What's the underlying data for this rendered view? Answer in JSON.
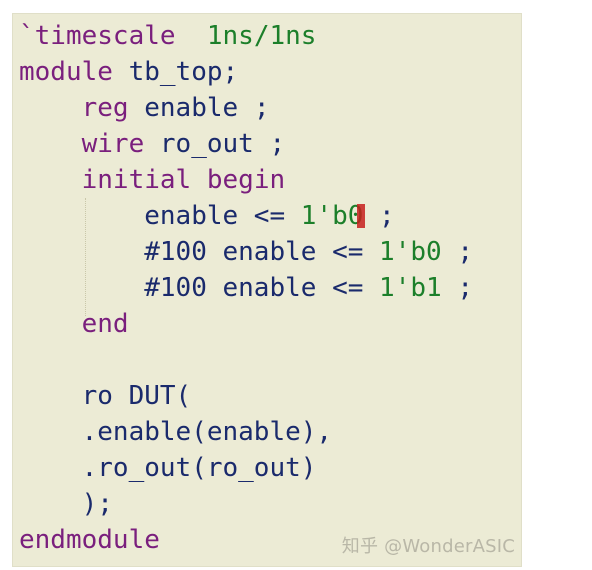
{
  "code": {
    "lines": [
      {
        "indent": "",
        "parts": [
          {
            "t": "kw",
            "v": "`timescale"
          },
          {
            "t": "sp",
            "v": "  "
          },
          {
            "t": "str",
            "v": "1ns/1ns"
          }
        ]
      },
      {
        "indent": "",
        "parts": [
          {
            "t": "kw",
            "v": "module"
          },
          {
            "t": "sp",
            "v": " "
          },
          {
            "t": "id",
            "v": "tb_top;"
          }
        ]
      },
      {
        "indent": "    ",
        "parts": [
          {
            "t": "kw",
            "v": "reg"
          },
          {
            "t": "sp",
            "v": " "
          },
          {
            "t": "id",
            "v": "enable ;"
          }
        ]
      },
      {
        "indent": "    ",
        "parts": [
          {
            "t": "kw",
            "v": "wire"
          },
          {
            "t": "sp",
            "v": " "
          },
          {
            "t": "id",
            "v": "ro_out ;"
          }
        ]
      },
      {
        "indent": "    ",
        "parts": [
          {
            "t": "kw",
            "v": "initial"
          },
          {
            "t": "sp",
            "v": " "
          },
          {
            "t": "kw",
            "v": "begin"
          }
        ]
      },
      {
        "indent": "        ",
        "parts": [
          {
            "t": "id",
            "v": "enable <= "
          },
          {
            "t": "str",
            "v": "1'b0"
          },
          {
            "t": "cursor",
            "v": ""
          },
          {
            "t": "id",
            "v": " ;"
          }
        ]
      },
      {
        "indent": "        ",
        "parts": [
          {
            "t": "id",
            "v": "#100 enable <= "
          },
          {
            "t": "str",
            "v": "1'b0"
          },
          {
            "t": "id",
            "v": " ;"
          }
        ]
      },
      {
        "indent": "        ",
        "parts": [
          {
            "t": "id",
            "v": "#100 enable <= "
          },
          {
            "t": "str",
            "v": "1'b1"
          },
          {
            "t": "id",
            "v": " ;"
          }
        ]
      },
      {
        "indent": "    ",
        "parts": [
          {
            "t": "kw",
            "v": "end"
          }
        ]
      },
      {
        "indent": "",
        "parts": []
      },
      {
        "indent": "    ",
        "parts": [
          {
            "t": "id",
            "v": "ro DUT("
          }
        ]
      },
      {
        "indent": "    ",
        "parts": [
          {
            "t": "id",
            "v": ".enable(enable),"
          }
        ]
      },
      {
        "indent": "    ",
        "parts": [
          {
            "t": "id",
            "v": ".ro_out(ro_out)"
          }
        ]
      },
      {
        "indent": "    ",
        "parts": [
          {
            "t": "id",
            "v": ");"
          }
        ]
      },
      {
        "indent": "",
        "parts": [
          {
            "t": "kw",
            "v": "endmodule"
          }
        ]
      }
    ]
  },
  "watermark": "知乎 @WonderASIC",
  "colors": {
    "background": "#ecebd5",
    "keyword": "#7a1f7d",
    "string": "#1c7f2a",
    "identifier": "#1a2a6c",
    "cursor": "#c7201d"
  }
}
